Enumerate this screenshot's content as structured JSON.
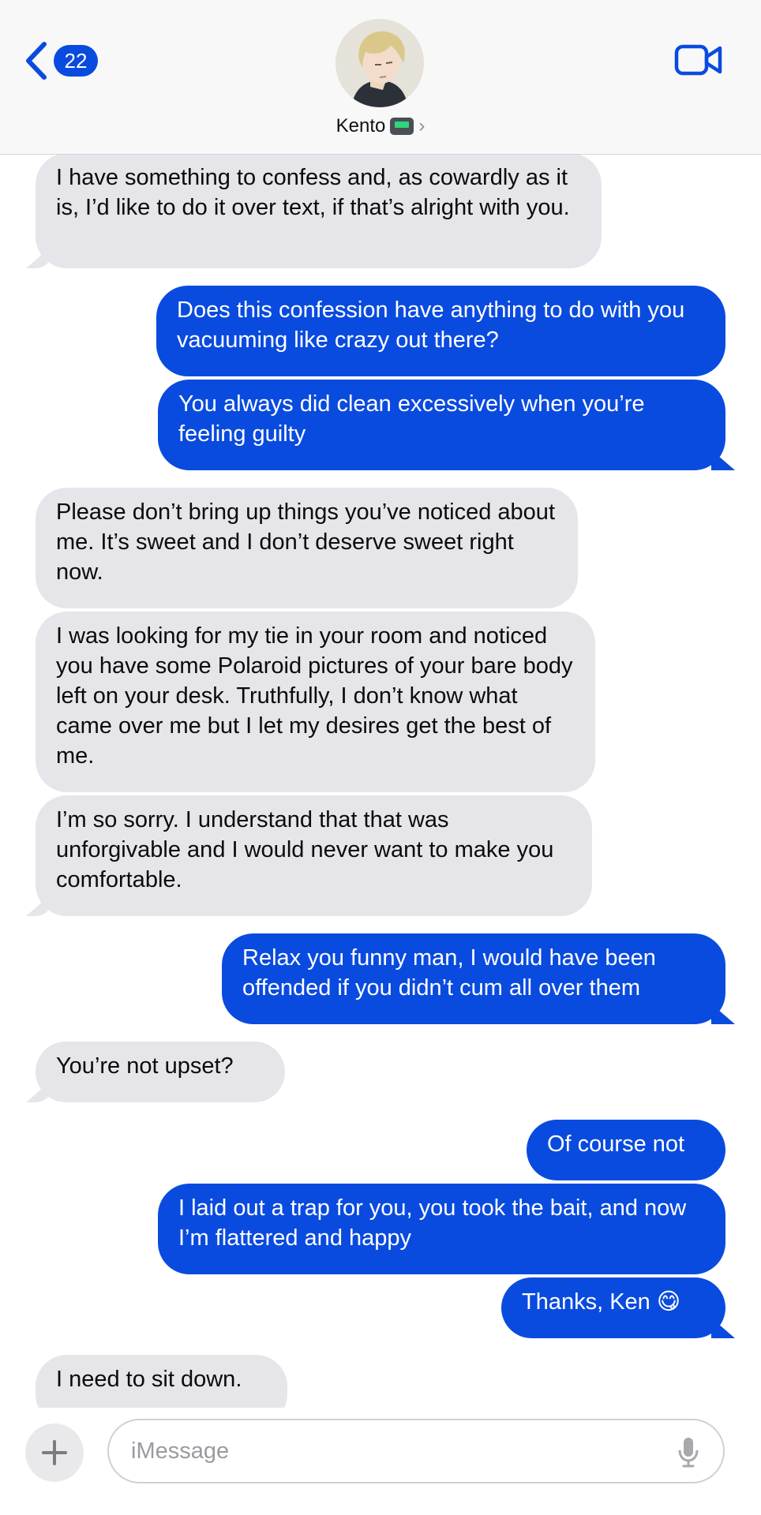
{
  "header": {
    "back_count": "22",
    "contact_name": "Kento",
    "chevron": "›",
    "icons": [
      "back-chevron-icon",
      "pager-icon",
      "video-camera-icon"
    ]
  },
  "messages": [
    {
      "sender": "them",
      "text": "I have something to confess and, as cowardly as it is, I’d like to do it over text, if that’s alright with you."
    },
    {
      "sender": "me",
      "text": "Does this confession have anything to do with you vacuuming like crazy out there?"
    },
    {
      "sender": "me",
      "text": "You always did clean excessively when you’re feeling guilty"
    },
    {
      "sender": "them",
      "text": "Please don’t bring up things you’ve noticed about me. It’s sweet and I don’t deserve sweet right now."
    },
    {
      "sender": "them",
      "text": "I was looking for my tie in your room and noticed you have some Polaroid pictures of your bare body left on your desk. Truthfully, I don’t know what came over me but I let my desires get the best of me."
    },
    {
      "sender": "them",
      "text": "I’m so sorry. I understand that that was unforgivable and I would never want to make you comfortable."
    },
    {
      "sender": "me",
      "text": "Relax you funny man, I would have been offended if you didn’t cum all over them"
    },
    {
      "sender": "them",
      "text": "You’re not upset?"
    },
    {
      "sender": "me",
      "text": "Of course not"
    },
    {
      "sender": "me",
      "text": "I laid out a trap for you, you took the bait, and now I’m flattered and happy"
    },
    {
      "sender": "me",
      "text": "Thanks, Ken 😋"
    },
    {
      "sender": "them",
      "text": "I need to sit down."
    }
  ],
  "composer": {
    "placeholder": "iMessage",
    "icons": [
      "plus-icon",
      "microphone-icon"
    ]
  },
  "colors": {
    "accent": "#0a4bdf",
    "incoming_bubble": "#e5e5ea"
  }
}
